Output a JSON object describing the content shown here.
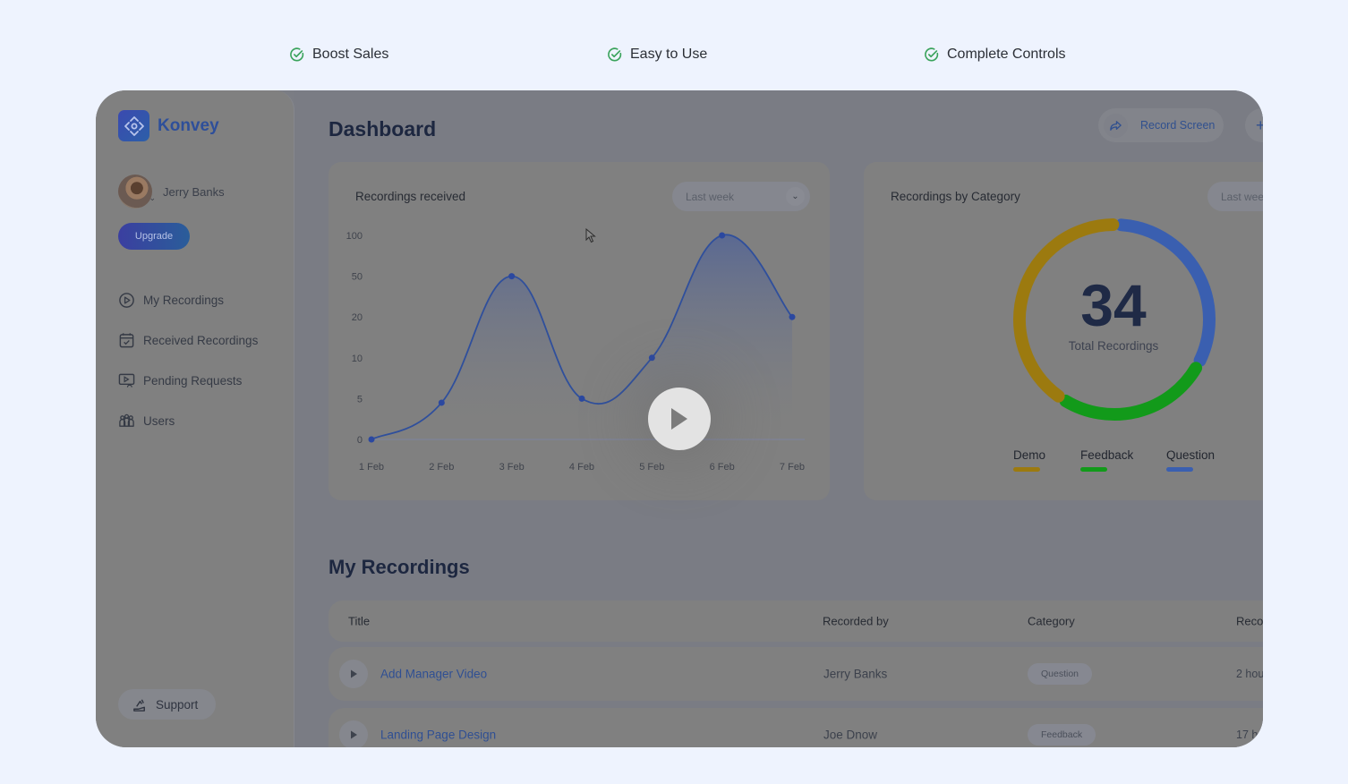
{
  "features": [
    {
      "label": "Boost Sales",
      "icon": "check-circle-icon"
    },
    {
      "label": "Easy to Use",
      "icon": "check-circle-icon"
    },
    {
      "label": "Complete Controls",
      "icon": "check-circle-icon"
    }
  ],
  "colors": {
    "page_bg": "#eef3fe",
    "check": "#3aa35c",
    "accent": "#2f4f93",
    "demo": "#9c7a0f",
    "feedback": "#129a1a",
    "question": "#3a5fb0",
    "line": "#2f4f9c"
  },
  "sidebar": {
    "brand": "Konvey",
    "user_name": "Jerry Banks",
    "upgrade_label": "Upgrade",
    "items": [
      {
        "label": "My Recordings",
        "icon": "play-circle-icon"
      },
      {
        "label": "Received Recordings",
        "icon": "calendar-check-icon"
      },
      {
        "label": "Pending Requests",
        "icon": "screen-play-icon"
      },
      {
        "label": "Users",
        "icon": "users-icon"
      }
    ],
    "support_label": "Support"
  },
  "header": {
    "title": "Dashboard",
    "record_label": "Record Screen",
    "plus_label": "+"
  },
  "recordings_chart": {
    "title": "Recordings received",
    "range": "Last week"
  },
  "category_chart": {
    "title": "Recordings by Category",
    "range": "Last wee",
    "total": "34",
    "total_label": "Total Recordings",
    "legend": [
      {
        "label": "Demo",
        "key": "demo"
      },
      {
        "label": "Feedback",
        "key": "feedback"
      },
      {
        "label": "Question",
        "key": "question"
      }
    ]
  },
  "chart_data": [
    {
      "type": "area",
      "title": "Recordings received",
      "categories": [
        "1 Feb",
        "2 Feb",
        "3 Feb",
        "4 Feb",
        "5 Feb",
        "6 Feb",
        "7 Feb"
      ],
      "yticks": [
        "0",
        "5",
        "10",
        "20",
        "50",
        "100"
      ],
      "y_scale": "ordinal-tick (0,5,10,20,50,100 equally spaced)",
      "values": [
        0,
        4.5,
        50,
        5,
        10,
        100,
        20
      ],
      "xlabel": "",
      "ylabel": "",
      "grid": false
    },
    {
      "type": "pie",
      "title": "Recordings by Category",
      "center_value": 34,
      "center_label": "Total Recordings",
      "labels": [
        "Question",
        "Feedback",
        "Demo"
      ],
      "values": [
        11,
        9,
        14
      ],
      "legend": "bottom"
    }
  ],
  "my_recordings": {
    "title": "My Recordings",
    "columns": [
      "Title",
      "Recorded by",
      "Category",
      "Reco"
    ],
    "rows": [
      {
        "title": "Add Manager Video",
        "recorded_by": "Jerry Banks",
        "category": "Question",
        "time": "2 hou"
      },
      {
        "title": "Landing Page Design",
        "recorded_by": "Joe Dnow",
        "category": "Feedback",
        "time": "17 h"
      }
    ]
  }
}
